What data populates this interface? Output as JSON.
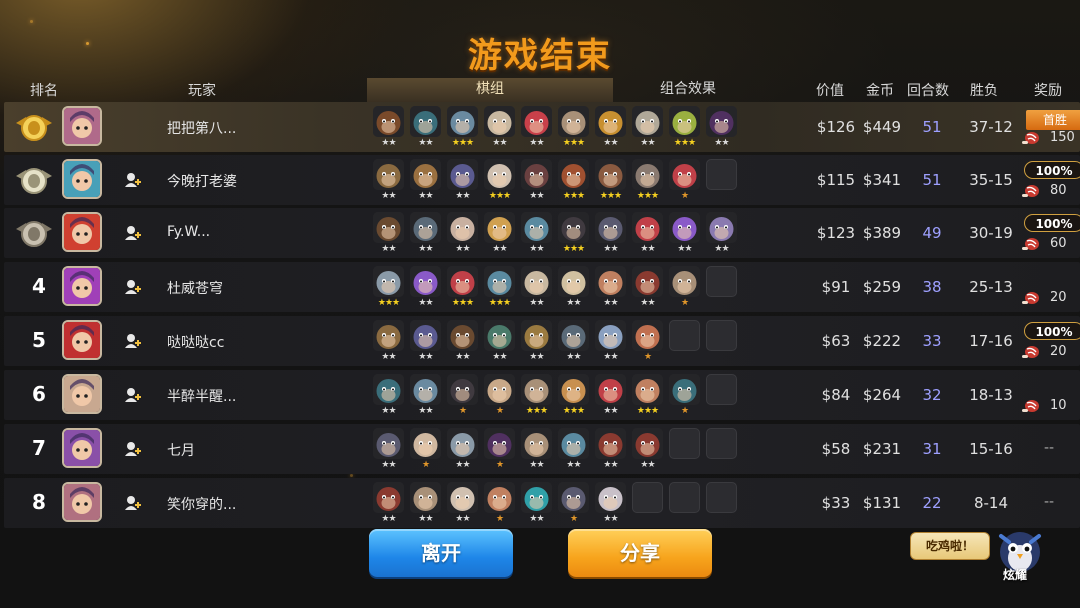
{
  "title": "游戏结束",
  "headers": {
    "rank": "排名",
    "player": "玩家",
    "pieces": "棋组",
    "synergy": "组合效果",
    "value": "价值",
    "gold": "金币",
    "rounds": "回合数",
    "winloss": "胜负",
    "reward": "奖励"
  },
  "rows": [
    {
      "rank": "1",
      "medal": "gold",
      "name": "把把第八...",
      "value": "$126",
      "gold": "$449",
      "rounds": "51",
      "winloss": "37-12",
      "badge": "首胜",
      "amount": "150",
      "units": [
        2,
        2,
        3,
        2,
        2,
        3,
        2,
        2,
        3,
        2
      ],
      "faces": [
        "#7a4a2a",
        "#3a6e7a",
        "#6a8aa0",
        "#c8b8a0",
        "#c8404a",
        "#a89078",
        "#c89030",
        "#b0a898",
        "#9ab040",
        "#503060"
      ]
    },
    {
      "rank": "2",
      "medal": "silver",
      "name": "今晚打老婆",
      "value": "$115",
      "gold": "$341",
      "rounds": "51",
      "winloss": "35-15",
      "badge": "100%",
      "amount": "80",
      "units": [
        2,
        2,
        2,
        3,
        2,
        3,
        3,
        3,
        1,
        0
      ],
      "faces": [
        "#8a6a40",
        "#9a7040",
        "#5a5a90",
        "#d0c0b0",
        "#6a4040",
        "#a05030",
        "#8a5a40",
        "#8a7a70",
        "#c04048",
        "#2c2c30"
      ]
    },
    {
      "rank": "3",
      "medal": "bronze",
      "name": "Fy.W...",
      "value": "$123",
      "gold": "$389",
      "rounds": "49",
      "winloss": "30-19",
      "badge": "100%",
      "amount": "60",
      "units": [
        2,
        2,
        2,
        2,
        2,
        3,
        2,
        2,
        2,
        2
      ],
      "faces": [
        "#6a4a30",
        "#5a6a78",
        "#c8b0a0",
        "#d0a050",
        "#5a8aa0",
        "#403a40",
        "#5a5a70",
        "#c04048",
        "#8a5ac8",
        "#8a7ab0"
      ]
    },
    {
      "rank": "4",
      "medal": "",
      "name": "杜威苍穹",
      "value": "$91",
      "gold": "$259",
      "rounds": "38",
      "winloss": "25-13",
      "badge": "",
      "amount": "20",
      "units": [
        3,
        2,
        3,
        3,
        2,
        2,
        2,
        2,
        1,
        0
      ],
      "faces": [
        "#8a9aa8",
        "#8a5ac8",
        "#c04048",
        "#5a8aa0",
        "#c8b8a0",
        "#d0c0a0",
        "#c08060",
        "#8a3a30",
        "#a89078",
        "#2c2c30"
      ]
    },
    {
      "rank": "5",
      "medal": "",
      "name": "哒哒哒cc",
      "value": "$63",
      "gold": "$222",
      "rounds": "33",
      "winloss": "17-16",
      "badge": "100%",
      "amount": "20",
      "units": [
        2,
        2,
        2,
        2,
        2,
        2,
        2,
        1,
        0,
        0
      ],
      "faces": [
        "#8a6a40",
        "#5a5a90",
        "#6a4a30",
        "#4a7a6a",
        "#9a7a40",
        "#5a6a78",
        "#8aa0c0",
        "#c07050",
        "#2c2c30",
        "#2c2c30"
      ]
    },
    {
      "rank": "6",
      "medal": "",
      "name": "半醉半醒...",
      "value": "$84",
      "gold": "$264",
      "rounds": "32",
      "winloss": "18-13",
      "badge": "",
      "amount": "10",
      "units": [
        2,
        2,
        1,
        1,
        3,
        3,
        2,
        3,
        1,
        0
      ],
      "faces": [
        "#3a6e7a",
        "#6a8aa0",
        "#403a40",
        "#c8a888",
        "#a89078",
        "#c89050",
        "#c04048",
        "#c08060",
        "#3a6e7a",
        "#2c2c30"
      ]
    },
    {
      "rank": "7",
      "medal": "",
      "name": "七月",
      "value": "$58",
      "gold": "$231",
      "rounds": "31",
      "winloss": "15-16",
      "badge": "",
      "amount": "--",
      "units": [
        2,
        1,
        2,
        1,
        2,
        2,
        2,
        2,
        0,
        0
      ],
      "faces": [
        "#5a5a70",
        "#d0b8a0",
        "#8a9aa8",
        "#503060",
        "#a89078",
        "#5a8aa0",
        "#8a3a30",
        "#8a3a30",
        "#2c2c30",
        "#2c2c30"
      ]
    },
    {
      "rank": "8",
      "medal": "",
      "name": "笑你穿的...",
      "value": "$33",
      "gold": "$131",
      "rounds": "22",
      "winloss": "8-14",
      "badge": "",
      "amount": "--",
      "units": [
        2,
        2,
        2,
        1,
        2,
        1,
        2,
        0,
        0,
        0
      ],
      "faces": [
        "#8a3a30",
        "#a89078",
        "#d0c0b0",
        "#c08060",
        "#30a0a8",
        "#5a5a70",
        "#c8c0c8",
        "#2c2c30",
        "#2c2c30",
        "#2c2c30"
      ]
    }
  ],
  "avatars": [
    "#b06a8a",
    "#48a0b8",
    "#d04030",
    "#a040b8",
    "#c03030",
    "#c8a890",
    "#8a50a8",
    "#b07080"
  ],
  "buttons": {
    "leave": "离开",
    "share": "分享"
  },
  "chicken": "吃鸡啦！",
  "mascot": "炫耀",
  "colors": {
    "title": "#f29a1c",
    "rounds": "#9ea0ff",
    "leave": "#1e86e8",
    "share": "#f7a41c"
  }
}
